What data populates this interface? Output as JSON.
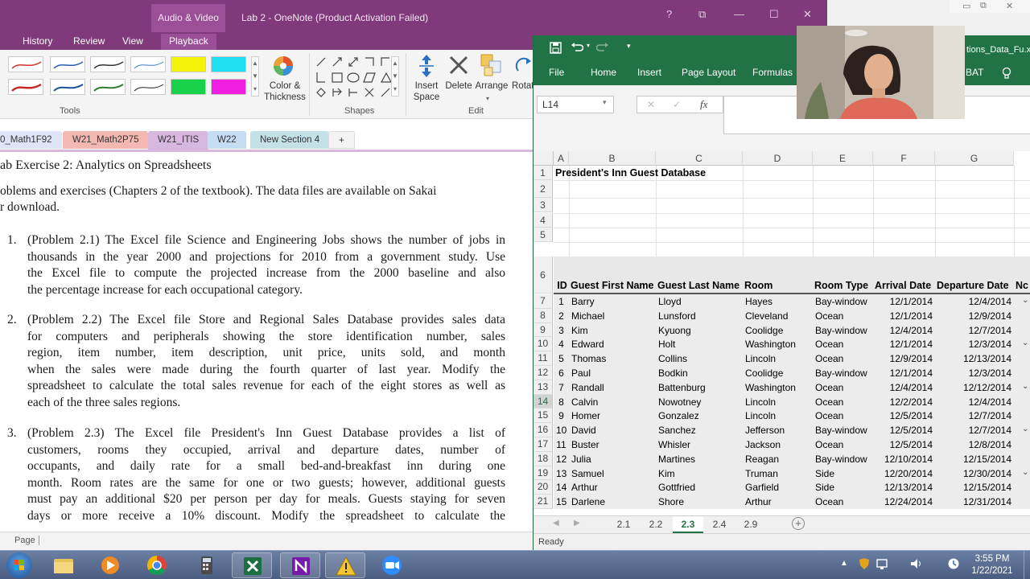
{
  "onenote": {
    "context_tab": "Audio & Video",
    "title": "Lab 2 - OneNote (Product Activation Failed)",
    "window_buttons": [
      "?",
      "⧉",
      "—",
      "☐",
      "✕"
    ],
    "tabs": [
      "History",
      "Review",
      "View",
      "Playback"
    ],
    "ribbon": {
      "color_thickness": [
        "Color &",
        "Thickness"
      ],
      "insert_space": [
        "Insert",
        "Space"
      ],
      "delete": "Delete",
      "arrange": "Arrange",
      "rotate": "Rotat",
      "groups": [
        "Tools",
        "Shapes",
        "Edit"
      ]
    },
    "sections": [
      "0_Math1F92",
      "W21_Math2P75",
      "W21_ITIS",
      "W22",
      "New Section 4",
      "+"
    ],
    "page": {
      "heading": "ab Exercise 2: Analytics on Spreadsheets",
      "intro": [
        "oblems and exercises (Chapters 2 of the textbook). The data files are available on Sakai",
        "r download."
      ],
      "problems": [
        {
          "num": "1.",
          "lines": [
            "(Problem 2.1) The Excel file Science and Engineering Jobs shows the number of jobs in",
            "thousands in the year 2000 and projections for 2010 from a government study. Use",
            "the Excel file to compute the projected increase from the 2000 baseline and also",
            "the percentage increase for each occupational category."
          ]
        },
        {
          "num": "2.",
          "lines": [
            "(Problem 2.2) The Excel file Store and Regional Sales Database provides sales data",
            "for computers and peripherals showing the store identification number, sales",
            "region, item number, item description, unit price, units sold, and month",
            "when the sales were made during the fourth quarter of last year. Modify the",
            "spreadsheet to calculate the total sales revenue for each of the eight stores as well as",
            "each of the three sales regions."
          ]
        },
        {
          "num": "3.",
          "lines": [
            "(Problem 2.3) The Excel file President's Inn Guest Database provides a list of",
            "customers, rooms they occupied, arrival and departure dates, number of",
            "occupants, and daily rate for a small bed-and-breakfast inn during one",
            "month. Room rates are the same for one or two guests; however, additional guests",
            "must pay an additional $20 per person per day for meals. Guests staying for seven",
            "days or more receive a 10% discount. Modify the spreadsheet to calculate the"
          ]
        }
      ]
    },
    "status": {
      "page": "Page"
    }
  },
  "excel": {
    "title_fragment": "tions_Data_Fu.x",
    "tabs": [
      "File",
      "Home",
      "Insert",
      "Page Layout",
      "Formulas",
      "BAT"
    ],
    "name_box": "L14",
    "fx": "fx",
    "columns": [
      "A",
      "B",
      "C",
      "D",
      "E",
      "F",
      "G"
    ],
    "sheet_title": "President's Inn Guest Database",
    "headers": [
      "ID",
      "Guest First Name",
      "Guest Last Name",
      "Room",
      "Room Type",
      "Arrival Date",
      "Departure Date",
      "Nc"
    ],
    "rows": [
      [
        "7",
        "1",
        "Barry",
        "Lloyd",
        "Hayes",
        "Bay-window",
        "12/1/2014",
        "12/4/2014"
      ],
      [
        "8",
        "2",
        "Michael",
        "Lunsford",
        "Cleveland",
        "Ocean",
        "12/1/2014",
        "12/9/2014"
      ],
      [
        "9",
        "3",
        "Kim",
        "Kyuong",
        "Coolidge",
        "Bay-window",
        "12/4/2014",
        "12/7/2014"
      ],
      [
        "10",
        "4",
        "Edward",
        "Holt",
        "Washington",
        "Ocean",
        "12/1/2014",
        "12/3/2014"
      ],
      [
        "11",
        "5",
        "Thomas",
        "Collins",
        "Lincoln",
        "Ocean",
        "12/9/2014",
        "12/13/2014"
      ],
      [
        "12",
        "6",
        "Paul",
        "Bodkin",
        "Coolidge",
        "Bay-window",
        "12/1/2014",
        "12/3/2014"
      ],
      [
        "13",
        "7",
        "Randall",
        "Battenburg",
        "Washington",
        "Ocean",
        "12/4/2014",
        "12/12/2014"
      ],
      [
        "14",
        "8",
        "Calvin",
        "Nowotney",
        "Lincoln",
        "Ocean",
        "12/2/2014",
        "12/4/2014"
      ],
      [
        "15",
        "9",
        "Homer",
        "Gonzalez",
        "Lincoln",
        "Ocean",
        "12/5/2014",
        "12/7/2014"
      ],
      [
        "16",
        "10",
        "David",
        "Sanchez",
        "Jefferson",
        "Bay-window",
        "12/5/2014",
        "12/7/2014"
      ],
      [
        "17",
        "11",
        "Buster",
        "Whisler",
        "Jackson",
        "Ocean",
        "12/5/2014",
        "12/8/2014"
      ],
      [
        "18",
        "12",
        "Julia",
        "Martines",
        "Reagan",
        "Bay-window",
        "12/10/2014",
        "12/15/2014"
      ],
      [
        "19",
        "13",
        "Samuel",
        "Kim",
        "Truman",
        "Side",
        "12/20/2014",
        "12/30/2014"
      ],
      [
        "20",
        "14",
        "Arthur",
        "Gottfried",
        "Garfield",
        "Side",
        "12/13/2014",
        "12/15/2014"
      ],
      [
        "21",
        "15",
        "Darlene",
        "Shore",
        "Arthur",
        "Ocean",
        "12/24/2014",
        "12/31/2014"
      ]
    ],
    "sheets": [
      "2.1",
      "2.2",
      "2.3",
      "2.4",
      "2.9"
    ],
    "active_sheet": "2.3",
    "status": "Ready"
  },
  "taskbar": {
    "apps": [
      "start-orb-icon",
      "file-explorer-icon",
      "media-player-icon",
      "chrome-icon",
      "calculator-icon",
      "excel-icon",
      "onenote-icon",
      "warning-app-icon",
      "zoom-icon"
    ],
    "time": "3:55 PM",
    "date": "1/22/2021"
  },
  "colors": {
    "onenote_purple": "#80397b",
    "excel_green": "#217346",
    "taskbar": "#4b5d80"
  }
}
